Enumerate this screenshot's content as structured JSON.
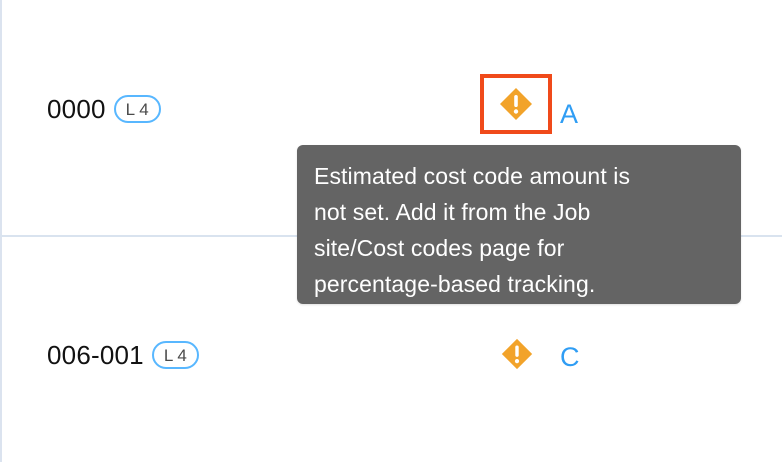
{
  "rows": [
    {
      "code": "0000",
      "level": "L 4",
      "status": "A"
    },
    {
      "code": "006-001",
      "level": "L 4",
      "status": "C"
    }
  ],
  "warning": {
    "icon_name": "warning-diamond-icon"
  },
  "tooltip": {
    "lines": [
      "Estimated cost code amount is",
      "not set. Add it from the Job",
      "site/Cost codes page for",
      "percentage-based tracking."
    ]
  },
  "colors": {
    "highlight_box": "#f04a1a",
    "warning": "#f2a32a",
    "status_text": "#2f9df4",
    "badge_border": "#58b7ff",
    "tooltip_bg": "#646464"
  }
}
